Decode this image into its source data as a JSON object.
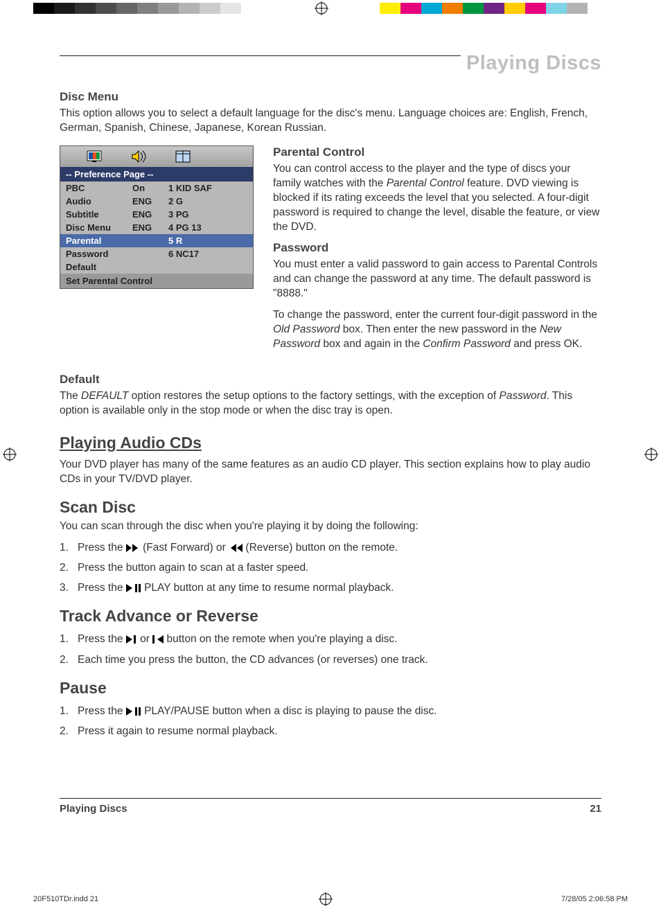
{
  "colorbar": {
    "greys": [
      "#000000",
      "#1a1a1a",
      "#333333",
      "#4d4d4d",
      "#666666",
      "#808080",
      "#999999",
      "#b3b3b3",
      "#cccccc",
      "#e6e6e6",
      "#ffffff"
    ],
    "colors": [
      "#ffee00",
      "#e5007e",
      "#00a6d6",
      "#ef7d00",
      "#009640",
      "#6e2585",
      "#ffcc00",
      "#e5007e",
      "#7fd4e8",
      "#b3b3b3"
    ]
  },
  "header": {
    "title": "Playing Discs"
  },
  "discmenu": {
    "heading": "Disc Menu",
    "para": "This option allows you to select a default language for the disc's menu. Language choices are: English, French, German, Spanish, Chinese, Japanese, Korean Russian."
  },
  "prefbox": {
    "title": "--  Preference Page  --",
    "rows": [
      {
        "c1": "PBC",
        "c2": "On",
        "c3": "1 KID SAF",
        "sel": false
      },
      {
        "c1": "Audio",
        "c2": "ENG",
        "c3": "2 G",
        "sel": false
      },
      {
        "c1": "Subtitle",
        "c2": "ENG",
        "c3": "3 PG",
        "sel": false
      },
      {
        "c1": "Disc Menu",
        "c2": "ENG",
        "c3": "4 PG 13",
        "sel": false
      },
      {
        "c1": "Parental",
        "c2": "",
        "c3": "5 R",
        "sel": true
      },
      {
        "c1": "Password",
        "c2": "",
        "c3": "6 NC17",
        "sel": false
      },
      {
        "c1": "Default",
        "c2": "",
        "c3": "",
        "sel": false
      }
    ],
    "footer": "Set Parental Control"
  },
  "rightcol": {
    "parental_h": "Parental Control",
    "parental_p": "You can control access to the player and the type of discs your family watches with the Parental Control feature. DVD viewing is blocked if its rating exceeds the level that you selected. A four-digit password is required to change the level, disable the feature, or view the DVD.",
    "password_h": "Password",
    "password_p1": "You must enter a valid password to gain access to Parental Controls and can change the password at any time.  The default password is \"8888.\"",
    "password_p2": "To change the password, enter the current four-digit password in the Old Password box. Then enter the new password in the New Password box and again in the Confirm Password and press OK."
  },
  "default_sec": {
    "heading": "Default",
    "para": "The DEFAULT option restores the setup options to the factory settings, with the exception of Password. This option is available only in the stop mode or when the disc tray is open."
  },
  "audiocd": {
    "heading": "Playing Audio CDs",
    "para": "Your DVD player has many of the same features as an audio CD player. This section explains how to play audio CDs in your TV/DVD player."
  },
  "scan": {
    "heading": "Scan Disc",
    "intro": "You can scan through the disc when you're playing it by doing the following:",
    "steps": [
      {
        "pre": "Press the ",
        "icon": "ff",
        "mid": " (Fast Forward) or ",
        "icon2": "rw",
        "post": " (Reverse) button on the remote."
      },
      {
        "text": "Press the button again to scan at a faster speed."
      },
      {
        "pre": "Press the  ",
        "icon": "playpause",
        "post": "  PLAY button at any time to resume normal playback."
      }
    ]
  },
  "track": {
    "heading": "Track Advance or Reverse",
    "steps": [
      {
        "pre": "Press the ",
        "icon": "next",
        "mid": " or  ",
        "icon2": "prev",
        "post": " button on the remote when you're playing a disc."
      },
      {
        "text": "Each time you press the button, the CD advances (or reverses) one track."
      }
    ]
  },
  "pause": {
    "heading": "Pause",
    "steps": [
      {
        "pre": "Press the ",
        "icon": "playpause2",
        "post": " PLAY/PAUSE button when a disc is playing to pause the disc."
      },
      {
        "text": "Press it again to resume normal playback."
      }
    ]
  },
  "footer": {
    "left": "Playing Discs",
    "right": "21"
  },
  "slug": {
    "left": "20F510TDr.indd   21",
    "right": "7/28/05   2:06:58 PM"
  }
}
